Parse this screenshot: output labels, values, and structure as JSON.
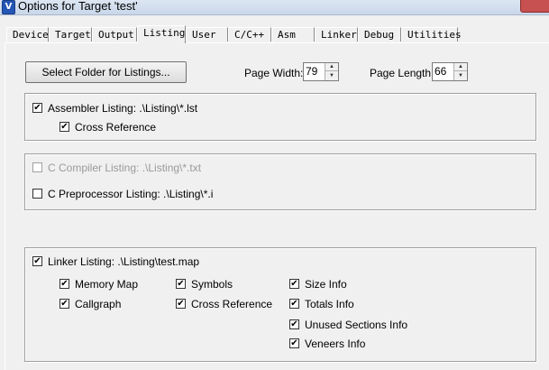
{
  "window": {
    "title": "Options for Target 'test'",
    "icon": "uvision-icon"
  },
  "tabs": [
    "Device",
    "Target",
    "Output",
    "Listing",
    "User",
    "C/C++",
    "Asm",
    "Linker",
    "Debug",
    "Utilities"
  ],
  "active_tab": "Listing",
  "select_folder_button": "Select Folder for Listings...",
  "page_width": {
    "label": "Page Width:",
    "value": "79"
  },
  "page_length": {
    "label": "Page Length:",
    "value": "66"
  },
  "assembler": {
    "listing_label": "Assembler Listing:  .\\Listing\\*.lst",
    "listing_checked": true,
    "cross_reference_label": "Cross Reference",
    "cross_reference_checked": true
  },
  "c_compiler": {
    "label": "C Compiler Listing:  .\\Listing\\*.txt",
    "checked": false,
    "enabled": false
  },
  "c_preprocessor": {
    "label": "C Preprocessor Listing:  .\\Listing\\*.i",
    "checked": false
  },
  "linker": {
    "listing_label": "Linker Listing:  .\\Listing\\test.map",
    "listing_checked": true,
    "options": {
      "memory_map": "Memory Map",
      "callgraph": "Callgraph",
      "symbols": "Symbols",
      "cross_reference": "Cross Reference",
      "size_info": "Size Info",
      "totals_info": "Totals Info",
      "unused_sections_info": "Unused Sections Info",
      "veneers_info": "Veneers Info"
    }
  },
  "check_glyph": "✔",
  "spin_up": "▲",
  "spin_down": "▼"
}
